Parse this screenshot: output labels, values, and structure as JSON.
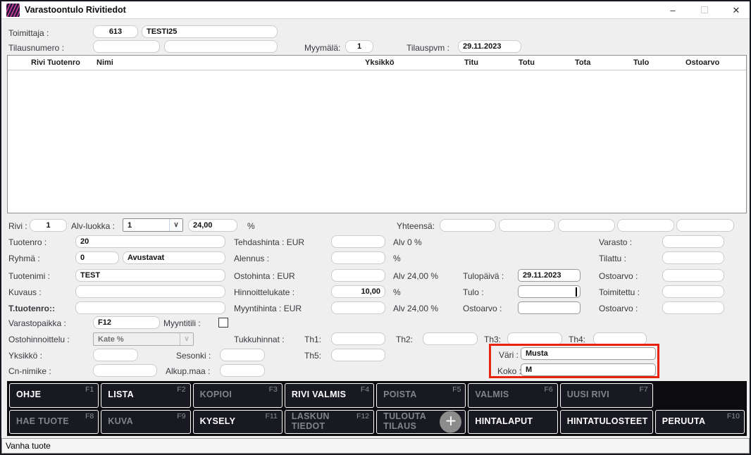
{
  "colors": {
    "annotation_red": "#e8220c",
    "button_panel_bg": "#0b0b10",
    "button_bg": "#191922",
    "window_bg": "#efefef"
  },
  "window": {
    "title": "Varastoontulo Rivitiedot",
    "icon": "app-logo-waves",
    "minimize_glyph": "–",
    "close_glyph": "✕"
  },
  "header": {
    "toimittaja_label": "Toimittaja :",
    "toimittaja_code": "613",
    "toimittaja_name": "TESTI25",
    "tilausnumero_label": "Tilausnumero :",
    "tilausnumero_value1": "",
    "tilausnumero_value2": "",
    "myymala_label": "Myymälä:",
    "myymala_value": "1",
    "tilauspvm_label": "Tilauspvm :",
    "tilauspvm_value": "29.11.2023"
  },
  "table": {
    "columns": [
      "Rivi",
      "Tuotenro",
      "Nimi",
      "Yksikkö",
      "Titu",
      "Totu",
      "Tota",
      "Tulo",
      "Ostoarvo"
    ],
    "rows": []
  },
  "form": {
    "rivi_label": "Rivi :",
    "rivi_value": "1",
    "alv_luokka_label": "Alv-luokka :",
    "alv_luokka_value": "1",
    "alv_pct_value": "24,00",
    "pct": "%",
    "yhteensa_label": "Yhteensä:",
    "tuotenro_label": "Tuotenro :",
    "tuotenro_value": "20",
    "tehdashinta_label": "Tehdashinta : EUR",
    "alv0_label": "Alv 0 %",
    "varasto_label": "Varasto :",
    "ryhma_label": "Ryhmä :",
    "ryhma_code": "0",
    "ryhma_name": "Avustavat",
    "alennus_label": "Alennus :",
    "tilattu_label": "Tilattu :",
    "tuotenimi_label": "Tuotenimi :",
    "tuotenimi_value": "TEST",
    "ostohinta_label": "Ostohinta : EUR",
    "alv24_label": "Alv 24,00 %",
    "tulopaiva_label": "Tulopäivä :",
    "tulopaiva_value": "29.11.2023",
    "ostoarvo_label": "Ostoarvo :",
    "kuvaus_label": "Kuvaus :",
    "hinnoittelukate_label": "Hinnoittelukate :",
    "hinnoittelukate_value": "10,00",
    "tulo_label": "Tulo :",
    "toimitettu_label": "Toimitettu :",
    "t_tuotenro_label": "T.tuotenro::",
    "myyntihinta_label": "Myyntihinta : EUR",
    "varastopaikka_label": "Varastopaikka :",
    "varastopaikka_value": "F12",
    "myyntitili_label": "Myyntitili :",
    "ostohinnoittelu_label": "Ostohinnoittelu :",
    "ostohinnoittelu_value": "Kate %",
    "tukkuhinnat_label": "Tukkuhinnat :",
    "th1_label": "Th1:",
    "th2_label": "Th2:",
    "th3_label": "Th3:",
    "th4_label": "Th4:",
    "th5_label": "Th5:",
    "yksikko_label": "Yksikkö :",
    "sesonki_label": "Sesonki :",
    "cn_nimike_label": "Cn-nimike :",
    "alkup_maa_label": "Alkup.maa :",
    "vari_label": "Väri :",
    "vari_value": "Musta",
    "koko_label": "Koko :",
    "koko_value": "M"
  },
  "buttons": {
    "plus_icon": "+",
    "row1": [
      {
        "label": "OHJE",
        "fkey": "F1"
      },
      {
        "label": "LISTA",
        "fkey": "F2"
      },
      {
        "label": "KOPIOI",
        "fkey": "F3"
      },
      {
        "label": "RIVI VALMIS",
        "fkey": "F4"
      },
      {
        "label": "POISTA",
        "fkey": "F5"
      },
      {
        "label": "VALMIS",
        "fkey": "F6"
      },
      {
        "label": "UUSI RIVI",
        "fkey": "F7"
      }
    ],
    "row2": [
      {
        "label": "HAE TUOTE",
        "fkey": "F8"
      },
      {
        "label": "KUVA",
        "fkey": "F9"
      },
      {
        "label": "KYSELY",
        "fkey": "F11"
      },
      {
        "label": "LASKUN TIEDOT",
        "fkey": "F12"
      },
      {
        "label": "TULOUTA TILAUS",
        "fkey": ""
      },
      {
        "label": "HINTALAPUT",
        "fkey": ""
      },
      {
        "label": "HINTATULOSTEET",
        "fkey": ""
      },
      {
        "label": "PERUUTA",
        "fkey": "F10"
      }
    ]
  },
  "statusbar": {
    "text": "Vanha tuote"
  }
}
